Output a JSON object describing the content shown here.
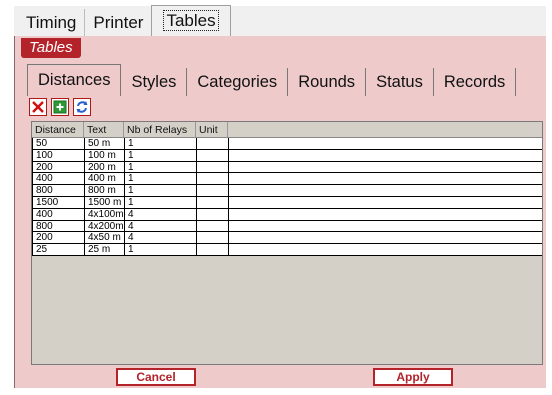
{
  "top_tabs": [
    {
      "label": "Timing"
    },
    {
      "label": "Printer"
    },
    {
      "label": "Tables"
    }
  ],
  "panel": {
    "title": "Tables"
  },
  "sub_tabs": [
    {
      "label": "Distances"
    },
    {
      "label": "Styles"
    },
    {
      "label": "Categories"
    },
    {
      "label": "Rounds"
    },
    {
      "label": "Status"
    },
    {
      "label": "Records"
    }
  ],
  "toolbar": {
    "delete_icon": "delete-x-icon",
    "add_icon": "add-plus-icon",
    "refresh_icon": "refresh-icon"
  },
  "grid": {
    "headers": [
      "Distance",
      "Text",
      "Nb of Relays",
      "Unit",
      ""
    ],
    "rows": [
      [
        "50",
        "50 m",
        "1",
        "",
        ""
      ],
      [
        "100",
        "100 m",
        "1",
        "",
        ""
      ],
      [
        "200",
        "200 m",
        "1",
        "",
        ""
      ],
      [
        "400",
        "400 m",
        "1",
        "",
        ""
      ],
      [
        "800",
        "800 m",
        "1",
        "",
        ""
      ],
      [
        "1500",
        "1500 m",
        "1",
        "",
        ""
      ],
      [
        "400",
        "4x100m",
        "4",
        "",
        ""
      ],
      [
        "800",
        "4x200m",
        "4",
        "",
        ""
      ],
      [
        "200",
        "4x50 m",
        "4",
        "",
        ""
      ],
      [
        "25",
        "25 m",
        "1",
        "",
        ""
      ]
    ]
  },
  "buttons": {
    "cancel": "Cancel",
    "apply": "Apply"
  },
  "colors": {
    "accent": "#b4232a",
    "panel_bg": "#efcaca"
  }
}
